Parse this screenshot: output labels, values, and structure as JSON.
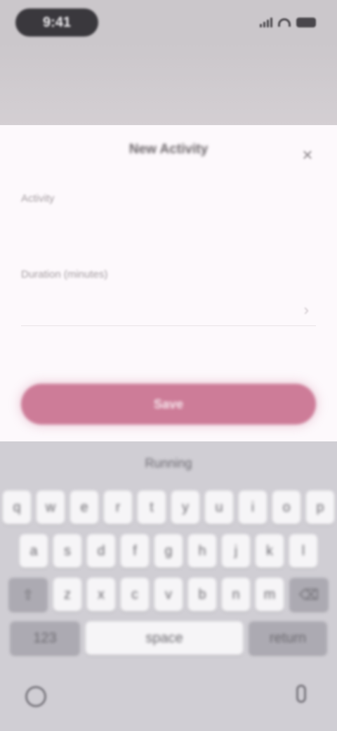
{
  "status_bar": {
    "time": "9:41"
  },
  "sheet": {
    "title": "New Activity",
    "close_icon": "×",
    "fields": [
      {
        "label": "Activity",
        "value": ""
      },
      {
        "label": "Duration (minutes)",
        "value": "",
        "placeholder": ""
      }
    ],
    "chevron_icon": "›",
    "primary_button_label": "Save"
  },
  "keyboard": {
    "suggestion": "Running",
    "rows": [
      [
        "q",
        "w",
        "e",
        "r",
        "t",
        "y",
        "u",
        "i",
        "o",
        "p"
      ],
      [
        "a",
        "s",
        "d",
        "f",
        "g",
        "h",
        "j",
        "k",
        "l"
      ],
      [
        "⇧",
        "z",
        "x",
        "c",
        "v",
        "b",
        "n",
        "m",
        "⌫"
      ],
      [
        "123",
        "space",
        "return"
      ]
    ]
  },
  "colors": {
    "accent": "#cd7c98",
    "sheet_background": "#fdf9fc",
    "keyboard_background": "#d0ced4"
  }
}
